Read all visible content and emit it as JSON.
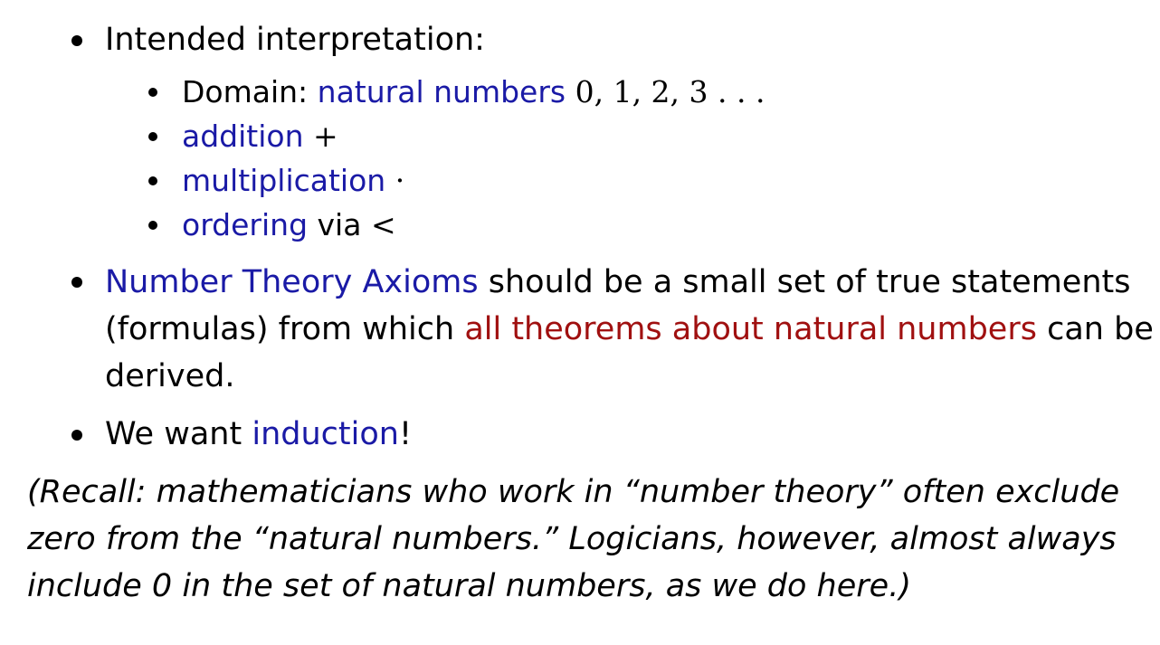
{
  "bullets": {
    "intended": "Intended interpretation:",
    "sub": {
      "domain_label": "Domain:",
      "domain_term": "natural numbers",
      "domain_math": "0, 1, 2, 3 . . .",
      "addition_term": "addition",
      "addition_sym": "+",
      "multiplication_term": "multiplication",
      "multiplication_sym": "·",
      "ordering_term": "ordering",
      "ordering_via": "via",
      "ordering_sym": "<"
    },
    "axioms": {
      "term": "Number Theory Axioms",
      "text1": "should be a small set of true statements (formulas) from which",
      "highlight": "all theorems about natural numbers",
      "text2": "can be derived."
    },
    "induction": {
      "text1": "We want",
      "term": "induction",
      "text2": "!"
    }
  },
  "recall": "(Recall: mathematicians who work in “number theory” often exclude zero from the “natural numbers.” Logicians, however, almost always include 0 in the set of natural numbers, as we do here.)",
  "colors": {
    "term_blue": "#1a1aa6",
    "highlight_red": "#a01010",
    "text": "#000000",
    "background": "#ffffff"
  }
}
